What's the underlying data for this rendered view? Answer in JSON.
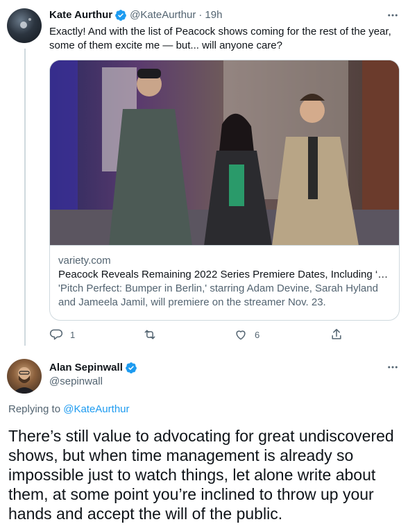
{
  "tweet1": {
    "name": "Kate Aurthur",
    "handle": "@KateAurthur",
    "time": "19h",
    "text": "Exactly! And with the list of Peacock shows coming for the rest of the year, some of them excite me — but... will anyone care?",
    "card": {
      "domain": "variety.com",
      "title": "Peacock Reveals Remaining 2022 Series Premiere Dates, Including ‘Pi…",
      "description": "'Pitch Perfect: Bumper in Berlin,' starring Adam Devine, Sarah Hyland and Jameela Jamil, will premiere on the streamer Nov. 23."
    },
    "actions": {
      "replies": "1",
      "retweets": "",
      "likes": "6"
    }
  },
  "tweet2": {
    "name": "Alan Sepinwall",
    "handle": "@sepinwall",
    "replying_prefix": "Replying to",
    "replying_to": "@KateAurthur",
    "text": "There’s still value to advocating for great undiscovered shows, but when time management is already so impossible just to watch things, let alone write about them, at some point you’re inclined to throw up your hands and accept the will of the public."
  },
  "colors": {
    "verified": "#1d9bf0",
    "link": "#1d9bf0",
    "secondary_text": "#536471",
    "border": "#cfd9de"
  },
  "icons": [
    "verified-badge-icon",
    "more-icon",
    "reply-icon",
    "retweet-icon",
    "like-icon",
    "share-icon"
  ]
}
